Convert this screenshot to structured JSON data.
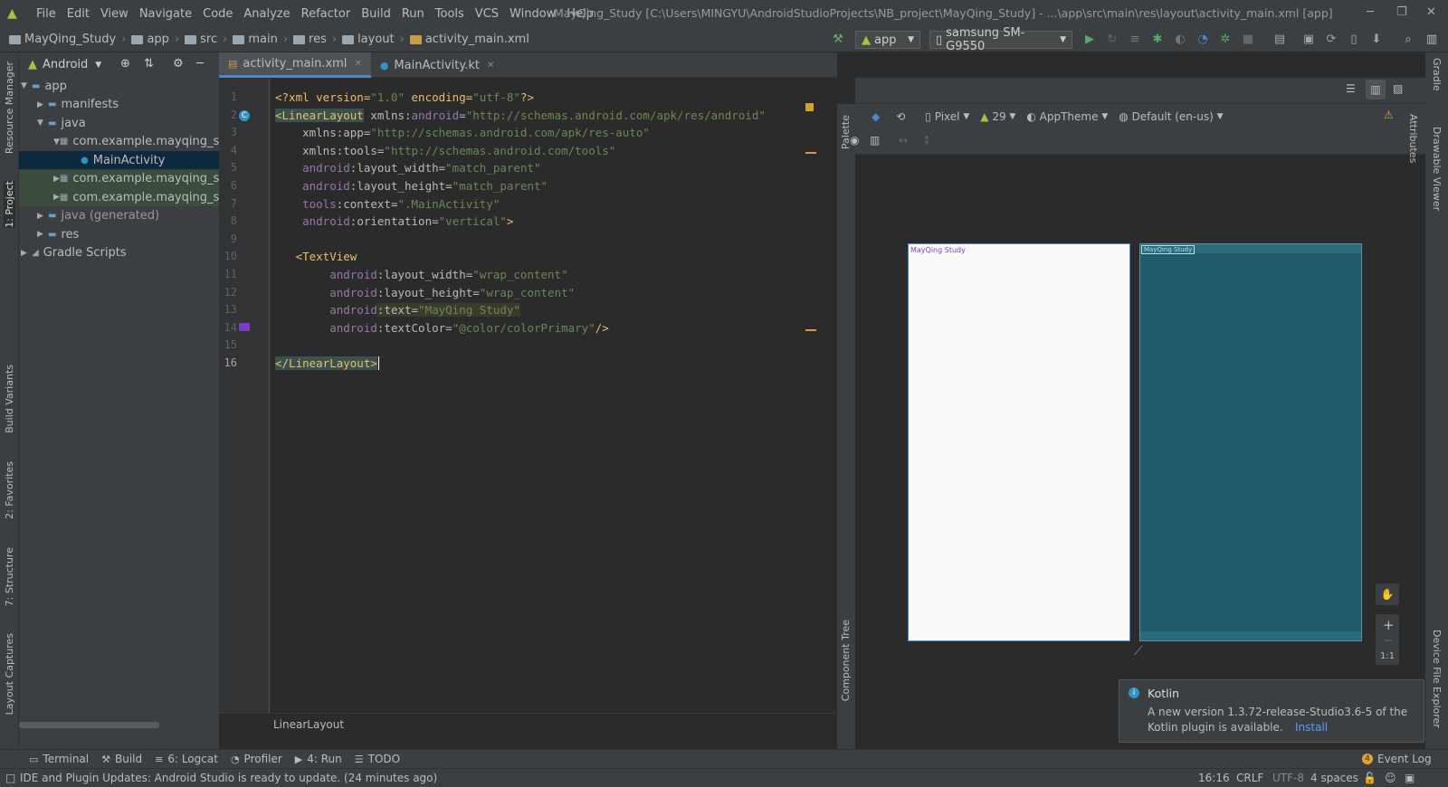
{
  "menu": {
    "items": [
      "File",
      "Edit",
      "View",
      "Navigate",
      "Code",
      "Analyze",
      "Refactor",
      "Build",
      "Run",
      "Tools",
      "VCS",
      "Window",
      "Help"
    ],
    "title": "MayQing_Study [C:\\Users\\MINGYU\\AndroidStudioProjects\\NB_project\\MayQing_Study] - ...\\app\\src\\main\\res\\layout\\activity_main.xml [app]"
  },
  "breadcrumbs": [
    "MayQing_Study",
    "app",
    "src",
    "main",
    "res",
    "layout",
    "activity_main.xml"
  ],
  "toolbar": {
    "run_config": "app",
    "device": "samsung SM-G9550"
  },
  "left_strip": {
    "resource_manager": "Resource Manager",
    "project": "1: Project",
    "build_variants": "Build Variants",
    "favorites": "2: Favorites",
    "structure": "7: Structure",
    "layout_captures": "Layout Captures"
  },
  "project": {
    "view_selector": "Android",
    "tree": [
      {
        "label": "app",
        "depth": 0,
        "expanded": true,
        "kind": "module"
      },
      {
        "label": "manifests",
        "depth": 1,
        "expanded": false,
        "kind": "folder"
      },
      {
        "label": "java",
        "depth": 1,
        "expanded": true,
        "kind": "folder"
      },
      {
        "label": "com.example.mayqing_stu",
        "depth": 2,
        "expanded": true,
        "kind": "package"
      },
      {
        "label": "MainActivity",
        "depth": 3,
        "expanded": null,
        "kind": "class",
        "selected": true
      },
      {
        "label": "com.example.mayqing_stu",
        "depth": 2,
        "expanded": false,
        "kind": "package"
      },
      {
        "label": "com.example.mayqing_stu",
        "depth": 2,
        "expanded": false,
        "kind": "package"
      },
      {
        "label": "java (generated)",
        "depth": 1,
        "expanded": false,
        "kind": "folder"
      },
      {
        "label": "res",
        "depth": 1,
        "expanded": false,
        "kind": "folder"
      },
      {
        "label": "Gradle Scripts",
        "depth": 0,
        "expanded": false,
        "kind": "gradle"
      }
    ]
  },
  "editor": {
    "tabs": [
      {
        "label": "activity_main.xml",
        "active": true
      },
      {
        "label": "MainActivity.kt",
        "active": false
      }
    ],
    "line_numbers": [
      "1",
      "2",
      "3",
      "4",
      "5",
      "6",
      "7",
      "8",
      "9",
      "10",
      "11",
      "12",
      "13",
      "14",
      "15",
      "16"
    ],
    "lines": [
      [
        [
          "pi",
          "<?xml version="
        ],
        [
          "val",
          "\"1.0\""
        ],
        [
          "pi",
          " encoding="
        ],
        [
          "val",
          "\"utf-8\""
        ],
        [
          "pi",
          "?>"
        ]
      ],
      [
        [
          "tag",
          "<LinearLayout"
        ],
        [
          "attr",
          " xmlns:"
        ],
        [
          "ns",
          "android"
        ],
        [
          "attr",
          "="
        ],
        [
          "val",
          "\"http://schemas.android.com/apk/res/android\""
        ]
      ],
      [
        [
          "attr",
          "    xmlns:app="
        ],
        [
          "val",
          "\"http://schemas.android.com/apk/res-auto\""
        ]
      ],
      [
        [
          "attr",
          "    xmlns:tools="
        ],
        [
          "val",
          "\"http://schemas.android.com/tools\""
        ]
      ],
      [
        [
          "ns",
          "    android"
        ],
        [
          "attr",
          ":layout_width="
        ],
        [
          "val",
          "\"match_parent\""
        ]
      ],
      [
        [
          "ns",
          "    android"
        ],
        [
          "attr",
          ":layout_height="
        ],
        [
          "val",
          "\"match_parent\""
        ]
      ],
      [
        [
          "ns",
          "    tools"
        ],
        [
          "attr",
          ":context="
        ],
        [
          "val",
          "\".MainActivity\""
        ]
      ],
      [
        [
          "ns",
          "    android"
        ],
        [
          "attr",
          ":orientation="
        ],
        [
          "val",
          "\"vertical\""
        ],
        [
          "tag",
          ">"
        ]
      ],
      [],
      [
        [
          "tag",
          "   <TextView"
        ]
      ],
      [
        [
          "ns",
          "        android"
        ],
        [
          "attr",
          ":layout_width="
        ],
        [
          "val",
          "\"wrap_content\""
        ]
      ],
      [
        [
          "ns",
          "        android"
        ],
        [
          "attr",
          ":layout_height="
        ],
        [
          "val",
          "\"wrap_content\""
        ]
      ],
      [
        [
          "ns",
          "        android"
        ],
        [
          "attr",
          ":text="
        ],
        [
          "val",
          "\"MayQing Study\""
        ]
      ],
      [
        [
          "ns",
          "        android"
        ],
        [
          "attr",
          ":textColor="
        ],
        [
          "val",
          "\"@color/colorPrimary\""
        ],
        [
          "tag",
          "/>"
        ]
      ],
      [],
      [
        [
          "tag",
          "</LinearLayout>"
        ]
      ]
    ],
    "footer_crumb": "LinearLayout"
  },
  "design": {
    "palette_label": "Palette",
    "component_tree_label": "Component Tree",
    "device_dd": "Pixel",
    "api_dd": "29",
    "theme_dd": "AppTheme",
    "locale_dd": "Default (en-us)",
    "preview_text": "MayQing Study",
    "zoom_ratio": "1:1"
  },
  "right_strip": {
    "gradle": "Gradle",
    "attributes": "Attributes",
    "drawable_viewer": "Drawable Viewer",
    "device_file_explorer": "Device File Explorer"
  },
  "notification": {
    "title": "Kotlin",
    "body1": "A new version 1.3.72-release-Studio3.6-5 of the",
    "body2": "Kotlin plugin is available.",
    "link": "Install"
  },
  "bottom_tools": [
    "Terminal",
    "Build",
    "6: Logcat",
    "Profiler",
    "4: Run",
    "TODO"
  ],
  "event_log": "Event Log",
  "status": {
    "message": "IDE and Plugin Updates: Android Studio is ready to update. (24 minutes ago)",
    "position": "16:16",
    "line_sep": "CRLF",
    "encoding": "UTF-8",
    "indent": "4 spaces"
  },
  "colors": {
    "accent": "#4a88c7",
    "android_green": "#a4c639",
    "preview_blueprint": "#1f5b6b"
  }
}
